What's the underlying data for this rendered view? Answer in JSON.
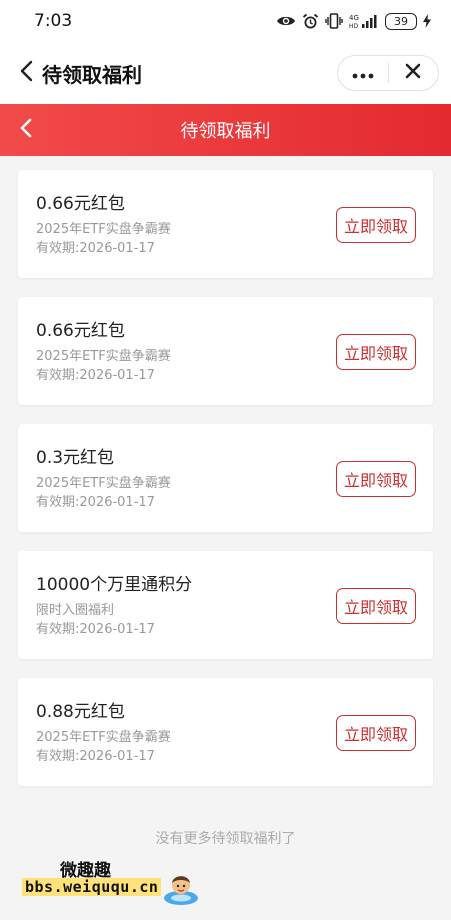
{
  "status_bar": {
    "time": "7:03",
    "network": "4G",
    "battery": "39"
  },
  "nav": {
    "title": "待领取福利"
  },
  "header": {
    "title": "待领取福利"
  },
  "items": [
    {
      "title": "0.66元红包",
      "subtitle": "2025年ETF实盘争霸赛",
      "expiry": "有效期:2026-01-17",
      "button": "立即领取"
    },
    {
      "title": "0.66元红包",
      "subtitle": "2025年ETF实盘争霸赛",
      "expiry": "有效期:2026-01-17",
      "button": "立即领取"
    },
    {
      "title": "0.3元红包",
      "subtitle": "2025年ETF实盘争霸赛",
      "expiry": "有效期:2026-01-17",
      "button": "立即领取"
    },
    {
      "title": "10000个万里通积分",
      "subtitle": "限时入圈福利",
      "expiry": "有效期:2026-01-17",
      "button": "立即领取"
    },
    {
      "title": "0.88元红包",
      "subtitle": "2025年ETF实盘争霸赛",
      "expiry": "有效期:2026-01-17",
      "button": "立即领取"
    }
  ],
  "footer": {
    "text": "没有更多待领取福利了"
  },
  "watermark": {
    "top": "微趣趣",
    "url": "bbs.weiququ.cn"
  },
  "colors": {
    "header_start": "#f24a4a",
    "header_end": "#e32a2f",
    "button_accent": "#c8302f",
    "background": "#f4f4f5"
  },
  "icons": {
    "status": [
      "eye-icon",
      "alarm-icon",
      "vibrate-icon",
      "signal-icon",
      "charging-icon"
    ],
    "nav": [
      "back-chevron-icon",
      "more-dots-icon",
      "close-icon"
    ]
  }
}
